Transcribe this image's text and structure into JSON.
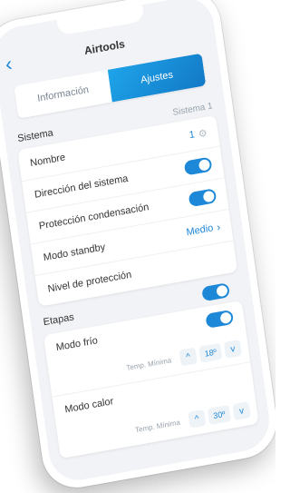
{
  "header": {
    "title": "Airtools",
    "back_icon": "chevron-left-icon"
  },
  "tabs": [
    {
      "label": "Información",
      "active": false
    },
    {
      "label": "Ajustes",
      "active": true
    }
  ],
  "sistema": {
    "section_label": "Sistema",
    "hint": "Sistema 1",
    "rows": {
      "nombre": {
        "label": "Nombre",
        "value": "1"
      },
      "direccion": {
        "label": "Dirección del sistema",
        "toggle_on": true
      },
      "proteccion": {
        "label": "Protección condensación",
        "toggle_on": true
      },
      "standby": {
        "label": "Modo standby",
        "value": "Medio"
      },
      "nivel": {
        "label": "Nivel de protección"
      }
    }
  },
  "etapas": {
    "section_label": "Etapas",
    "toggle_on": true,
    "frio": {
      "label": "Modo frío",
      "temp_label": "Temp. Mínima",
      "value": "18º",
      "toggle_on": true
    },
    "calor": {
      "label": "Modo calor",
      "temp_label": "Temp. Mínima",
      "value": "30º"
    }
  },
  "colors": {
    "accent": "#1e88d8",
    "background": "#f1f3f6"
  }
}
